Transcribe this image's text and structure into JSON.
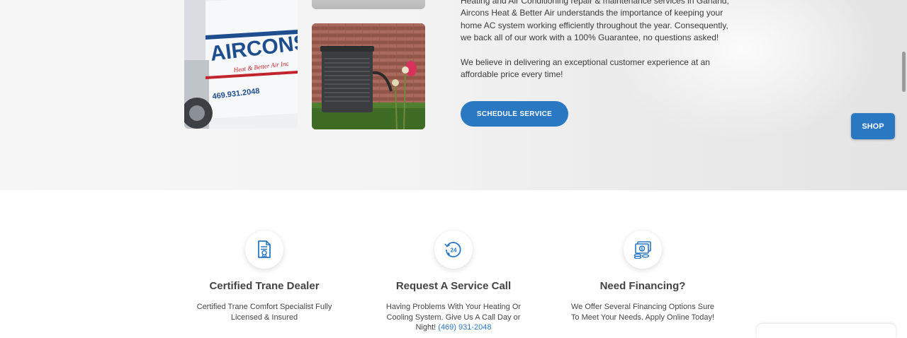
{
  "hero": {
    "paragraph_1": "Heating and Air Conditioning repair & maintenance services in Garland, Aircons Heat & Better Air understands the importance of keeping your home AC system working efficiently throughout the year. Consequently, we back all of our work with a 100% Guarantee, no questions asked!",
    "paragraph_2": "We believe in delivering an exceptional customer experience at an affordable price every time!",
    "schedule_button": "SCHEDULE SERVICE",
    "truck_photo": {
      "brand": "AIRCONS",
      "tagline": "Heat & Better Air Inc",
      "phone": "469.931.2048"
    }
  },
  "shop_button": "SHOP",
  "features": [
    {
      "icon": "certificate-document-icon",
      "title": "Certified Trane Dealer",
      "text": "Certified Trane Comfort Specialist Fully Licensed & Insured"
    },
    {
      "icon": "24-hour-phone-icon",
      "title": "Request A Service Call",
      "text": "Having Problems With Your Heating Or Cooling System. Give Us A Call Day or Night!",
      "phone": "(469) 931-2048"
    },
    {
      "icon": "money-financing-icon",
      "title": "Need Financing?",
      "text": "We Offer Several Financing Options Sure To Meet Your Needs. Apply Online Today!"
    }
  ],
  "colors": {
    "accent": "#2b78c2",
    "heading": "#444444",
    "body_text": "#3a3a3a"
  }
}
